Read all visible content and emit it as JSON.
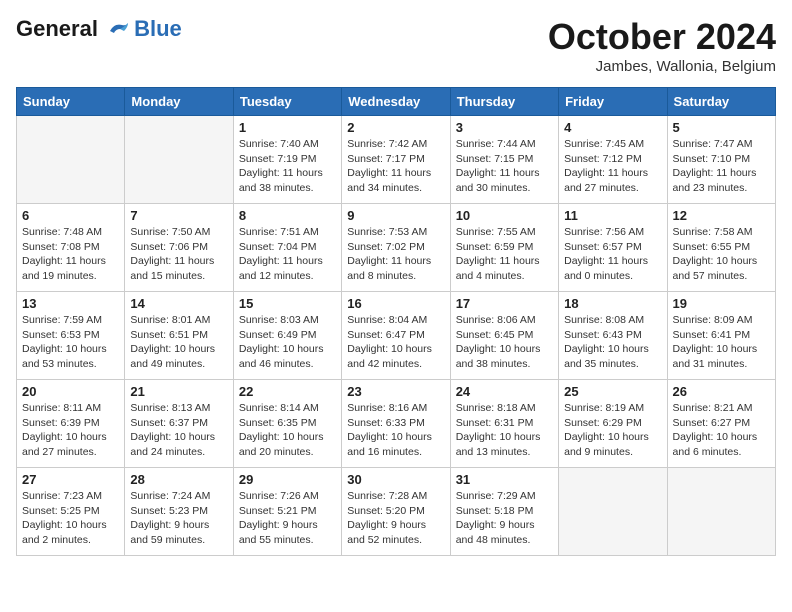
{
  "header": {
    "logo_line1": "General",
    "logo_line2": "Blue",
    "month_title": "October 2024",
    "location": "Jambes, Wallonia, Belgium"
  },
  "weekdays": [
    "Sunday",
    "Monday",
    "Tuesday",
    "Wednesday",
    "Thursday",
    "Friday",
    "Saturday"
  ],
  "weeks": [
    [
      {
        "day": "",
        "empty": true
      },
      {
        "day": "",
        "empty": true
      },
      {
        "day": "1",
        "sunrise": "Sunrise: 7:40 AM",
        "sunset": "Sunset: 7:19 PM",
        "daylight": "Daylight: 11 hours and 38 minutes."
      },
      {
        "day": "2",
        "sunrise": "Sunrise: 7:42 AM",
        "sunset": "Sunset: 7:17 PM",
        "daylight": "Daylight: 11 hours and 34 minutes."
      },
      {
        "day": "3",
        "sunrise": "Sunrise: 7:44 AM",
        "sunset": "Sunset: 7:15 PM",
        "daylight": "Daylight: 11 hours and 30 minutes."
      },
      {
        "day": "4",
        "sunrise": "Sunrise: 7:45 AM",
        "sunset": "Sunset: 7:12 PM",
        "daylight": "Daylight: 11 hours and 27 minutes."
      },
      {
        "day": "5",
        "sunrise": "Sunrise: 7:47 AM",
        "sunset": "Sunset: 7:10 PM",
        "daylight": "Daylight: 11 hours and 23 minutes."
      }
    ],
    [
      {
        "day": "6",
        "sunrise": "Sunrise: 7:48 AM",
        "sunset": "Sunset: 7:08 PM",
        "daylight": "Daylight: 11 hours and 19 minutes."
      },
      {
        "day": "7",
        "sunrise": "Sunrise: 7:50 AM",
        "sunset": "Sunset: 7:06 PM",
        "daylight": "Daylight: 11 hours and 15 minutes."
      },
      {
        "day": "8",
        "sunrise": "Sunrise: 7:51 AM",
        "sunset": "Sunset: 7:04 PM",
        "daylight": "Daylight: 11 hours and 12 minutes."
      },
      {
        "day": "9",
        "sunrise": "Sunrise: 7:53 AM",
        "sunset": "Sunset: 7:02 PM",
        "daylight": "Daylight: 11 hours and 8 minutes."
      },
      {
        "day": "10",
        "sunrise": "Sunrise: 7:55 AM",
        "sunset": "Sunset: 6:59 PM",
        "daylight": "Daylight: 11 hours and 4 minutes."
      },
      {
        "day": "11",
        "sunrise": "Sunrise: 7:56 AM",
        "sunset": "Sunset: 6:57 PM",
        "daylight": "Daylight: 11 hours and 0 minutes."
      },
      {
        "day": "12",
        "sunrise": "Sunrise: 7:58 AM",
        "sunset": "Sunset: 6:55 PM",
        "daylight": "Daylight: 10 hours and 57 minutes."
      }
    ],
    [
      {
        "day": "13",
        "sunrise": "Sunrise: 7:59 AM",
        "sunset": "Sunset: 6:53 PM",
        "daylight": "Daylight: 10 hours and 53 minutes."
      },
      {
        "day": "14",
        "sunrise": "Sunrise: 8:01 AM",
        "sunset": "Sunset: 6:51 PM",
        "daylight": "Daylight: 10 hours and 49 minutes."
      },
      {
        "day": "15",
        "sunrise": "Sunrise: 8:03 AM",
        "sunset": "Sunset: 6:49 PM",
        "daylight": "Daylight: 10 hours and 46 minutes."
      },
      {
        "day": "16",
        "sunrise": "Sunrise: 8:04 AM",
        "sunset": "Sunset: 6:47 PM",
        "daylight": "Daylight: 10 hours and 42 minutes."
      },
      {
        "day": "17",
        "sunrise": "Sunrise: 8:06 AM",
        "sunset": "Sunset: 6:45 PM",
        "daylight": "Daylight: 10 hours and 38 minutes."
      },
      {
        "day": "18",
        "sunrise": "Sunrise: 8:08 AM",
        "sunset": "Sunset: 6:43 PM",
        "daylight": "Daylight: 10 hours and 35 minutes."
      },
      {
        "day": "19",
        "sunrise": "Sunrise: 8:09 AM",
        "sunset": "Sunset: 6:41 PM",
        "daylight": "Daylight: 10 hours and 31 minutes."
      }
    ],
    [
      {
        "day": "20",
        "sunrise": "Sunrise: 8:11 AM",
        "sunset": "Sunset: 6:39 PM",
        "daylight": "Daylight: 10 hours and 27 minutes."
      },
      {
        "day": "21",
        "sunrise": "Sunrise: 8:13 AM",
        "sunset": "Sunset: 6:37 PM",
        "daylight": "Daylight: 10 hours and 24 minutes."
      },
      {
        "day": "22",
        "sunrise": "Sunrise: 8:14 AM",
        "sunset": "Sunset: 6:35 PM",
        "daylight": "Daylight: 10 hours and 20 minutes."
      },
      {
        "day": "23",
        "sunrise": "Sunrise: 8:16 AM",
        "sunset": "Sunset: 6:33 PM",
        "daylight": "Daylight: 10 hours and 16 minutes."
      },
      {
        "day": "24",
        "sunrise": "Sunrise: 8:18 AM",
        "sunset": "Sunset: 6:31 PM",
        "daylight": "Daylight: 10 hours and 13 minutes."
      },
      {
        "day": "25",
        "sunrise": "Sunrise: 8:19 AM",
        "sunset": "Sunset: 6:29 PM",
        "daylight": "Daylight: 10 hours and 9 minutes."
      },
      {
        "day": "26",
        "sunrise": "Sunrise: 8:21 AM",
        "sunset": "Sunset: 6:27 PM",
        "daylight": "Daylight: 10 hours and 6 minutes."
      }
    ],
    [
      {
        "day": "27",
        "sunrise": "Sunrise: 7:23 AM",
        "sunset": "Sunset: 5:25 PM",
        "daylight": "Daylight: 10 hours and 2 minutes."
      },
      {
        "day": "28",
        "sunrise": "Sunrise: 7:24 AM",
        "sunset": "Sunset: 5:23 PM",
        "daylight": "Daylight: 9 hours and 59 minutes."
      },
      {
        "day": "29",
        "sunrise": "Sunrise: 7:26 AM",
        "sunset": "Sunset: 5:21 PM",
        "daylight": "Daylight: 9 hours and 55 minutes."
      },
      {
        "day": "30",
        "sunrise": "Sunrise: 7:28 AM",
        "sunset": "Sunset: 5:20 PM",
        "daylight": "Daylight: 9 hours and 52 minutes."
      },
      {
        "day": "31",
        "sunrise": "Sunrise: 7:29 AM",
        "sunset": "Sunset: 5:18 PM",
        "daylight": "Daylight: 9 hours and 48 minutes."
      },
      {
        "day": "",
        "empty": true
      },
      {
        "day": "",
        "empty": true
      }
    ]
  ]
}
